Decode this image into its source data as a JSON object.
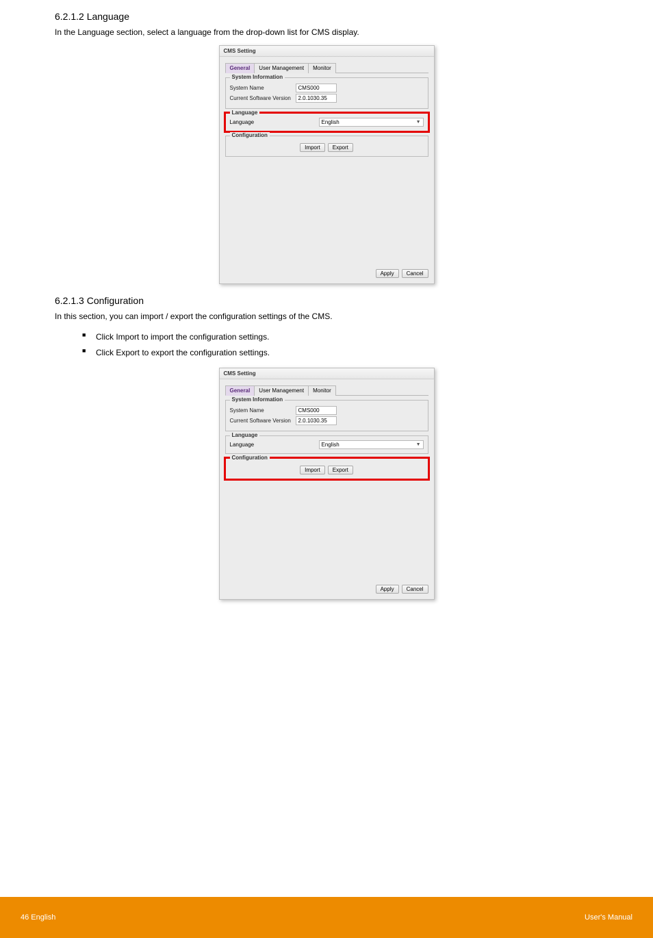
{
  "section_language": {
    "heading": "6.2.1.2 Language",
    "text": "In the Language section, select a language from the drop-down list for CMS display."
  },
  "section_config": {
    "heading": "6.2.1.3 Configuration",
    "text_line1": "In this section, you can import / export the configuration settings of the CMS.",
    "bullets": [
      "Click Import to import the configuration settings.",
      "Click Export to export the configuration settings."
    ]
  },
  "cms": {
    "title": "CMS Setting",
    "tabs": {
      "general": "General",
      "user": "User Management",
      "monitor": "Monitor"
    },
    "sysinfo": {
      "legend": "System Information",
      "rows": {
        "name_label": "System Name",
        "name_value": "CMS000",
        "ver_label": "Current Software Version",
        "ver_value": "2.0.1030.35"
      }
    },
    "language": {
      "legend": "Language",
      "label": "Language",
      "value": "English"
    },
    "config": {
      "legend": "Configuration",
      "import": "Import",
      "export": "Export"
    },
    "footer": {
      "apply": "Apply",
      "cancel": "Cancel"
    }
  },
  "page_footer": {
    "left": "46  English",
    "right": "User's Manual"
  }
}
